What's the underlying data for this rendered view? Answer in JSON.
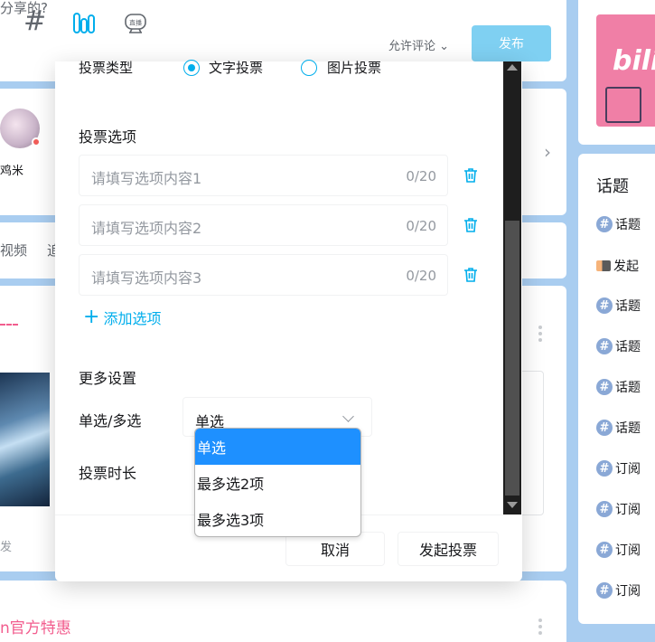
{
  "composer": {
    "prompt": "分享的?",
    "allow_comment": "允许评论",
    "publish": "发布",
    "live_label": "直播"
  },
  "following": {
    "name": "鸡米"
  },
  "tabs": {
    "video": "视频",
    "more": "追"
  },
  "feed": {
    "repost": "发",
    "promo": "n官方特惠"
  },
  "sidebar": {
    "banner_text": "bili",
    "topic_title": "话题",
    "items": [
      {
        "icon": "hash-icon",
        "label": "话题"
      },
      {
        "icon": "flag-icon",
        "label": "发起"
      },
      {
        "icon": "hash-icon",
        "label": "话题"
      },
      {
        "icon": "hash-icon",
        "label": "话题"
      },
      {
        "icon": "hash-icon",
        "label": "话题"
      },
      {
        "icon": "hash-icon",
        "label": "话题"
      },
      {
        "icon": "hash-icon",
        "label": "订阅"
      },
      {
        "icon": "hash-icon",
        "label": "订阅"
      },
      {
        "icon": "hash-icon",
        "label": "订阅"
      },
      {
        "icon": "hash-icon",
        "label": "订阅"
      }
    ]
  },
  "modal": {
    "vote_type_label": "投票类型",
    "vote_type_text": "文字投票",
    "vote_type_image": "图片投票",
    "options_title": "投票选项",
    "options": [
      {
        "placeholder": "请填写选项内容1",
        "count": "0/20"
      },
      {
        "placeholder": "请填写选项内容2",
        "count": "0/20"
      },
      {
        "placeholder": "请填写选项内容3",
        "count": "0/20"
      }
    ],
    "add_option": "添加选项",
    "more_settings": "更多设置",
    "select_label": "单选/多选",
    "select_value": "单选",
    "duration_label": "投票时长",
    "dropdown_options": [
      "单选",
      "最多选2项",
      "最多选3项"
    ],
    "cancel": "取消",
    "start": "发起投票"
  },
  "colors": {
    "accent": "#00aeec",
    "dropdown_highlight": "#1e90ff",
    "publish": "#7fd0f2",
    "pink": "#f25d8e"
  }
}
